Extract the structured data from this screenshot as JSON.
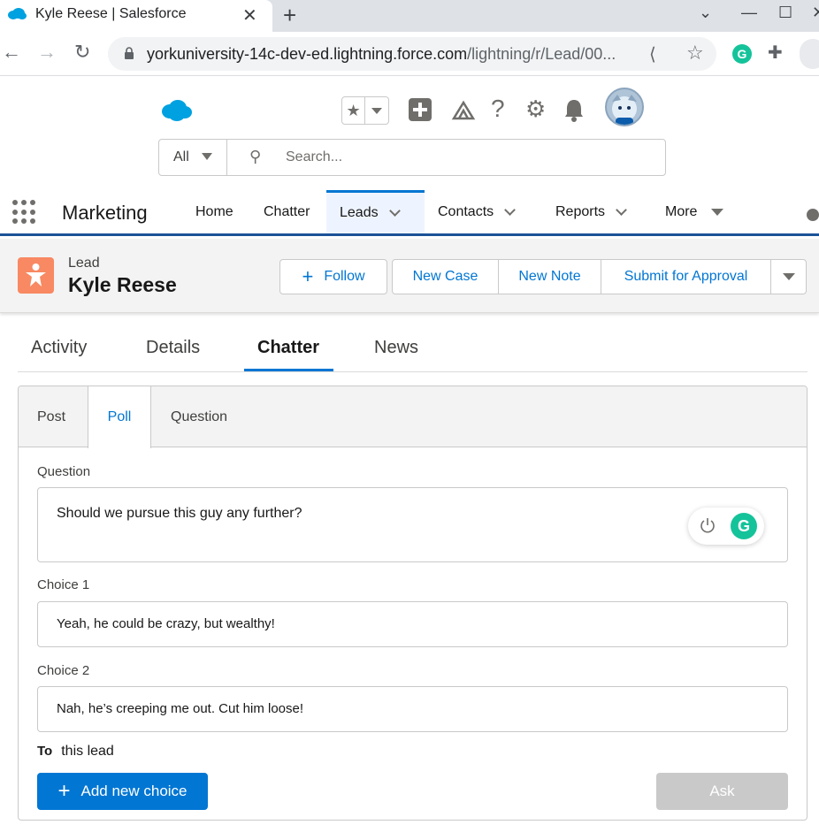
{
  "browser": {
    "tab_title": "Kyle Reese | Salesforce",
    "close_glyph": "✕",
    "newtab_glyph": "+",
    "url_host": "yorkuniversity-14c-dev-ed.lightning.force.com",
    "url_path": "/lightning/r/Lead/00..."
  },
  "header": {
    "search_scope": "All",
    "search_placeholder": "Search..."
  },
  "appnav": {
    "app_name": "Marketing",
    "items": [
      {
        "label": "Home"
      },
      {
        "label": "Chatter"
      },
      {
        "label": "Leads"
      },
      {
        "label": "Contacts"
      },
      {
        "label": "Reports"
      },
      {
        "label": "More"
      }
    ]
  },
  "record": {
    "type": "Lead",
    "name": "Kyle Reese",
    "actions": {
      "follow": "Follow",
      "new_case": "New Case",
      "new_note": "New Note",
      "submit": "Submit for Approval"
    }
  },
  "record_tabs": [
    "Activity",
    "Details",
    "Chatter",
    "News"
  ],
  "publisher": {
    "tabs": [
      "Post",
      "Poll",
      "Question"
    ],
    "question_label": "Question",
    "question_value": "Should we pursue this guy any further?",
    "choice1_label": "Choice 1",
    "choice1_value": "Yeah, he could be crazy, but wealthy!",
    "choice2_label": "Choice 2",
    "choice2_value": "Nah, he’s creeping me out. Cut him loose!",
    "to_label": "To",
    "to_value": "this lead",
    "add_choice": "Add new choice",
    "ask": "Ask"
  },
  "colors": {
    "brand_blue": "#0176d3",
    "nav_underline": "#1b5297",
    "lead_icon": "#f88962",
    "grammarly": "#15c39a"
  }
}
